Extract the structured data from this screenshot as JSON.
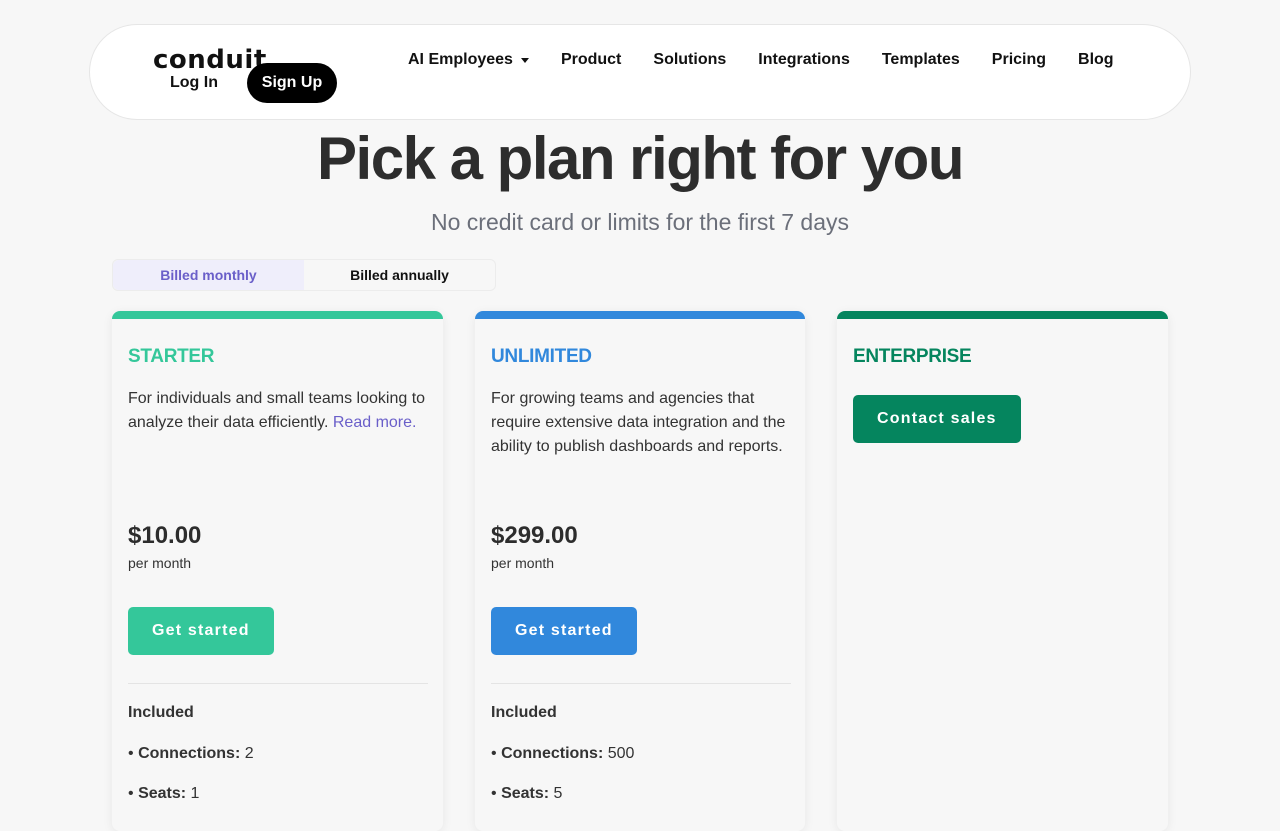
{
  "nav": {
    "logo": "conduit",
    "login": "Log In",
    "signup": "Sign Up",
    "items": [
      {
        "label": "AI Employees",
        "has_dropdown": true
      },
      {
        "label": "Product"
      },
      {
        "label": "Solutions"
      },
      {
        "label": "Integrations"
      },
      {
        "label": "Templates"
      },
      {
        "label": "Pricing"
      },
      {
        "label": "Blog"
      }
    ]
  },
  "hero": {
    "title": "Pick a plan right for you",
    "subtitle": "No credit card or limits for the first 7 days"
  },
  "billing_toggle": {
    "monthly": "Billed monthly",
    "annually": "Billed annually",
    "selected": "monthly"
  },
  "plans": [
    {
      "name": "STARTER",
      "color": "#34c79a",
      "description": "For individuals and small teams looking to analyze their data efficiently.",
      "read_more": "Read more.",
      "price": "$10.00",
      "period": "per month",
      "cta": "Get started",
      "included_label": "Included",
      "features": [
        {
          "bullet": "•",
          "name": "Connections",
          "sep": ":",
          "value": "2"
        },
        {
          "bullet": "•",
          "name": "Seats",
          "sep": ":",
          "value": "1"
        }
      ]
    },
    {
      "name": "UNLIMITED",
      "color": "#3188dc",
      "description": "For growing teams and agencies that require extensive data integration and the ability to publish dashboards and reports.",
      "price": "$299.00",
      "period": "per month",
      "cta": "Get started",
      "included_label": "Included",
      "features": [
        {
          "bullet": "•",
          "name": "Connections",
          "sep": ":",
          "value": "500"
        },
        {
          "bullet": "•",
          "name": "Seats",
          "sep": ":",
          "value": "5"
        }
      ]
    },
    {
      "name": "ENTERPRISE",
      "color": "#05855e",
      "cta": "Contact sales"
    }
  ],
  "colors": {
    "accent_purple": "#6a5fc9",
    "toggle_active_bg": "#efeefb",
    "page_bg": "#f7f7f7"
  }
}
